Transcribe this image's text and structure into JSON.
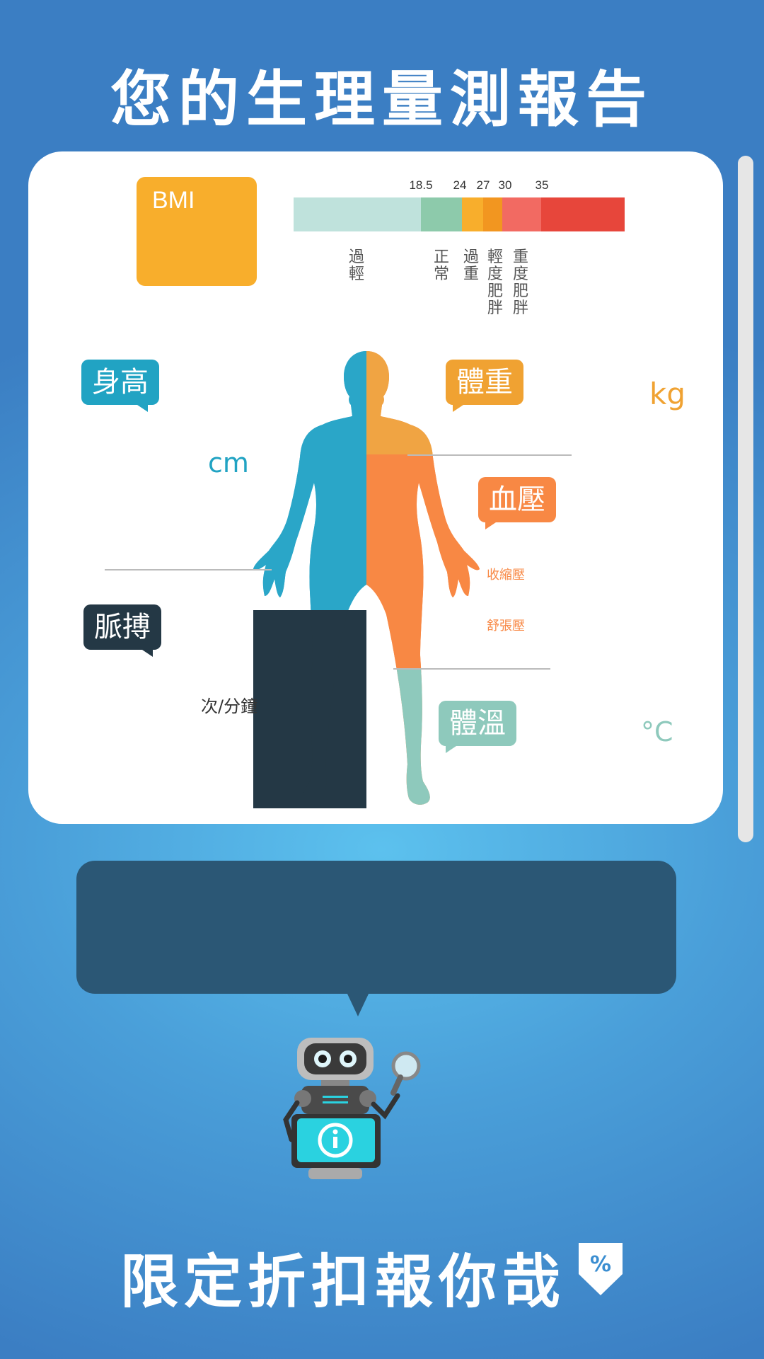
{
  "page": {
    "title": "您的生理量測報告"
  },
  "bmi": {
    "label": "BMI",
    "ticks": [
      "18.5",
      "24",
      "27",
      "30",
      "35"
    ],
    "categories": [
      "過輕",
      "正常",
      "過重",
      "輕度肥胖",
      "重度肥胖"
    ],
    "colors": [
      "#bfe2dc",
      "#8dcaab",
      "#f8ae2c",
      "#f29620",
      "#f26a62",
      "#e7463b"
    ]
  },
  "metrics": {
    "height": {
      "label": "身高",
      "unit": "cm",
      "color": "#21a3c3"
    },
    "weight": {
      "label": "體重",
      "unit": "kg",
      "color": "#f0a232"
    },
    "blood_pressure": {
      "label": "血壓",
      "color": "#f88844",
      "systolic_label": "收縮壓",
      "diastolic_label": "舒張壓"
    },
    "pulse": {
      "label": "脈搏",
      "unit": "次/分鐘",
      "color": "#243845"
    },
    "temperature": {
      "label": "體溫",
      "unit": "°C",
      "color": "#8ec9bc"
    }
  },
  "assistant": {
    "message": ""
  },
  "promo": {
    "text": "限定折扣報你哉",
    "icon": "percent-tag-down-icon"
  }
}
